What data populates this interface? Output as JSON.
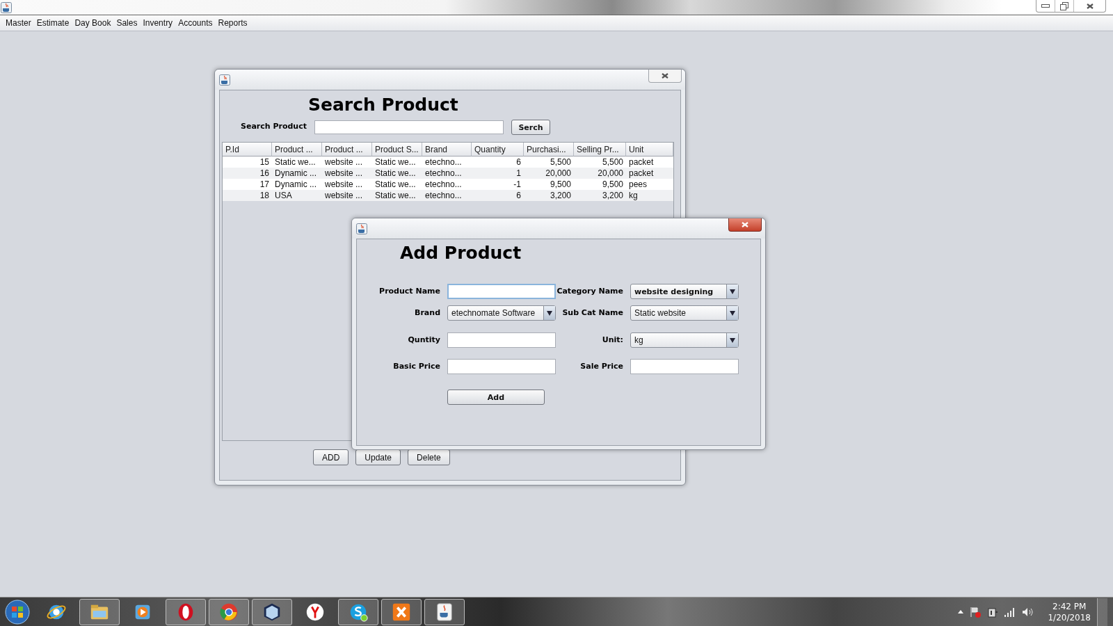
{
  "menu_bar": [
    "Master",
    "Estimate",
    "Day Book",
    "Sales",
    "Inventry",
    "Accounts",
    "Reports"
  ],
  "search_window": {
    "heading": "Search Product",
    "search_label": "Search Product",
    "search_button": "Serch",
    "table": {
      "columns": [
        "P.Id",
        "Product ...",
        "Product ...",
        "Product S...",
        "Brand",
        "Quantity",
        "Purchasi...",
        "Selling Pr...",
        "Unit"
      ],
      "rows": [
        [
          "15",
          "Static we...",
          "website ...",
          "Static we...",
          "etechno...",
          "6",
          "5,500",
          "5,500",
          "packet"
        ],
        [
          "16",
          "Dynamic ...",
          "website ...",
          "Static we...",
          "etechno...",
          "1",
          "20,000",
          "20,000",
          "packet"
        ],
        [
          "17",
          "Dynamic ...",
          "website ...",
          "Static we...",
          "etechno...",
          "-1",
          "9,500",
          "9,500",
          "pees"
        ],
        [
          "18",
          "USA",
          "website ...",
          "Static we...",
          "etechno...",
          "6",
          "3,200",
          "3,200",
          "kg"
        ]
      ]
    },
    "buttons": [
      "ADD",
      "Update",
      "Delete"
    ]
  },
  "add_dialog": {
    "heading": "Add Product",
    "fields": [
      {
        "label": "Product Name",
        "kind": "text",
        "focused": true
      },
      {
        "label": "Category Name",
        "kind": "dropdown",
        "value": "website designing",
        "focused": false,
        "bold": true
      },
      {
        "label": "Brand",
        "kind": "dropdown",
        "value": "etechnomate Software",
        "focused": false,
        "bold": false
      },
      {
        "label": "Sub Cat Name",
        "kind": "dropdown",
        "value": "Static website",
        "focused": false,
        "bold": false
      },
      {
        "label": "Quntity",
        "kind": "text",
        "focused": false
      },
      {
        "label": "Unit:",
        "kind": "dropdown",
        "value": "kg",
        "focused": false,
        "bold": false
      },
      {
        "label": "Basic Price",
        "kind": "text",
        "focused": false
      },
      {
        "label": "Sale Price",
        "kind": "text",
        "focused": false
      }
    ],
    "add_button": "Add"
  },
  "taskbar": {
    "items": [
      {
        "running": false
      },
      {
        "running": true
      },
      {
        "running": false
      },
      {
        "running": true
      },
      {
        "running": true
      },
      {
        "running": true
      },
      {
        "running": false
      },
      {
        "running": true
      },
      {
        "running": true
      },
      {
        "running": true
      }
    ],
    "time": "2:42 PM",
    "date": "1/20/2018"
  }
}
